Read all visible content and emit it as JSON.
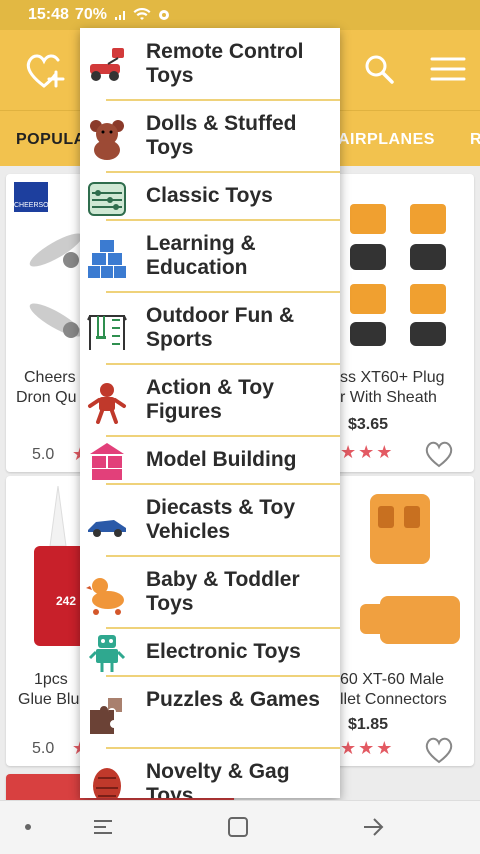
{
  "status_bar": {
    "time": "15:48",
    "battery": "70%",
    "signal_icon": "signal-icon",
    "wifi_icon": "wifi-icon",
    "settings_icon": "gear-icon"
  },
  "header": {
    "favorites_icon": "heart-plus-icon",
    "search_icon": "search-icon",
    "menu_icon": "hamburger-icon",
    "accent_color": "#f2c24e"
  },
  "tabs": [
    {
      "label": "POPULA"
    },
    {
      "label": "AIRPLANES"
    },
    {
      "label": "R"
    }
  ],
  "products": [
    {
      "badge": "CHEERSON",
      "title_line1": "Cheers",
      "title_line2": "Dron Qu",
      "rating": "5.0"
    },
    {
      "title_line1": "ss XT60+ Plug",
      "title_line2": "r With Sheath",
      "price": "$3.65"
    },
    {
      "title_line1": "1pcs",
      "title_line2": "Glue Blu",
      "rating": "5.0",
      "label_top": "242"
    },
    {
      "title_line1": "60 XT-60 Male",
      "title_line2": "llet Connectors",
      "price": "$1.85"
    }
  ],
  "menu": {
    "items": [
      {
        "label": "Remote Control Toys",
        "icon": "rc-car-icon"
      },
      {
        "label": "Dolls & Stuffed Toys",
        "icon": "teddy-bear-icon"
      },
      {
        "label": "Classic Toys",
        "icon": "abacus-icon"
      },
      {
        "label": "Learning & Education",
        "icon": "blocks-icon"
      },
      {
        "label": "Outdoor Fun & Sports",
        "icon": "playground-icon"
      },
      {
        "label": "Action & Toy Figures",
        "icon": "action-figure-icon"
      },
      {
        "label": "Model Building",
        "icon": "model-blocks-icon"
      },
      {
        "label": "Diecasts & Toy Vehicles",
        "icon": "toy-car-icon"
      },
      {
        "label": "Baby & Toddler Toys",
        "icon": "duck-toy-icon"
      },
      {
        "label": "Electronic Toys",
        "icon": "robot-icon"
      },
      {
        "label": "Puzzles & Games",
        "icon": "puzzle-icon"
      },
      {
        "label": "Novelty & Gag Toys",
        "icon": "novelty-toy-icon"
      }
    ]
  },
  "nav": {
    "back_icon": "back-icon",
    "home_icon": "home-icon",
    "recents_icon": "recents-icon",
    "dot_icon": "dot-icon"
  }
}
